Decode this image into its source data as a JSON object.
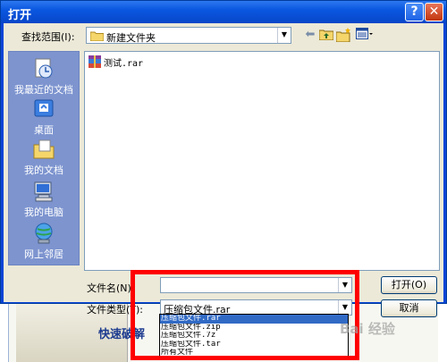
{
  "window": {
    "title": "打开"
  },
  "toolbar": {
    "lookin_label": "查找范围(I):",
    "lookin_value": "新建文件夹"
  },
  "places": [
    {
      "label": "我最近的文档",
      "icon": "recent-documents-icon"
    },
    {
      "label": "桌面",
      "icon": "desktop-icon"
    },
    {
      "label": "我的文档",
      "icon": "my-documents-icon"
    },
    {
      "label": "我的电脑",
      "icon": "my-computer-icon"
    },
    {
      "label": "网上邻居",
      "icon": "network-places-icon"
    }
  ],
  "files": [
    {
      "name": "测试.rar",
      "icon": "winrar-archive-icon"
    }
  ],
  "form": {
    "filename_label": "文件名(N):",
    "filename_value": "",
    "filetype_label": "文件类型(T):",
    "filetype_value": "压缩包文件.rar",
    "open_label": "打开(O)",
    "cancel_label": "取消"
  },
  "filetype_options": [
    "压缩包文件.rar",
    "压缩包文件.zip",
    "压缩包文件.7z",
    "压缩包文件.tar",
    "所有文件"
  ],
  "filetype_selected_index": 0,
  "background": {
    "button_label": "快速破解"
  },
  "watermark": "Bai 经验",
  "colors": {
    "highlight": "#ff0000",
    "titlebar": "#0a57e0",
    "places_bar": "#7d94cf",
    "selection": "#316ac5"
  }
}
